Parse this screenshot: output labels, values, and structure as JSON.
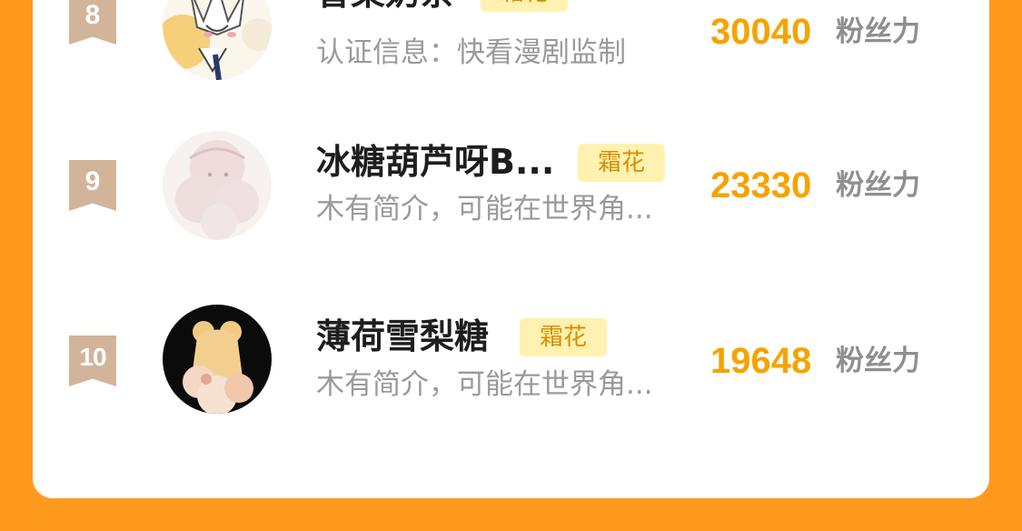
{
  "entries": [
    {
      "rank": "8",
      "name": "香菜奶茶",
      "badge": "霜花",
      "description": "认证信息：快看漫剧监制",
      "score": "30040",
      "unit": "粉丝力"
    },
    {
      "rank": "9",
      "name": "冰糖葫芦呀B...",
      "badge": "霜花",
      "description": "木有简介，可能在世界角...",
      "score": "23330",
      "unit": "粉丝力"
    },
    {
      "rank": "10",
      "name": "薄荷雪梨糖",
      "badge": "霜花",
      "description": "木有简介，可能在世界角...",
      "score": "19648",
      "unit": "粉丝力"
    }
  ],
  "colors": {
    "background": "#FF9A1F",
    "score": "#F6A300",
    "badge_bg": "#FFF2B0",
    "badge_text": "#D98E00",
    "rank_ribbon": "#D2B49A"
  }
}
